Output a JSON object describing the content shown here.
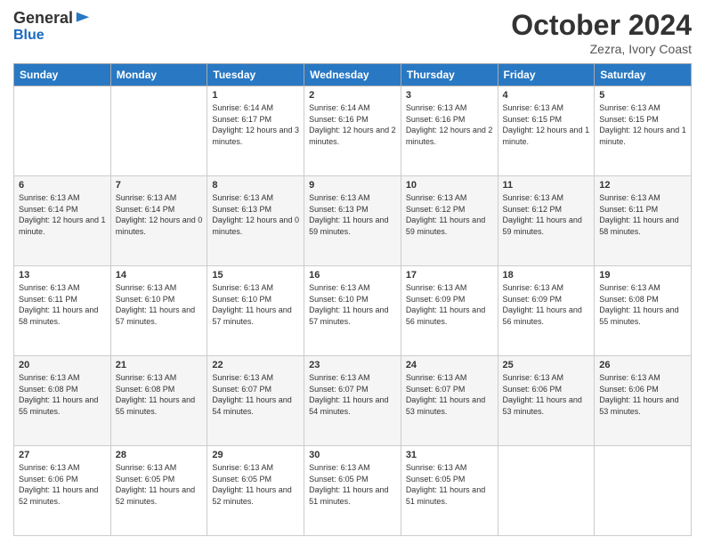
{
  "logo": {
    "general": "General",
    "blue": "Blue"
  },
  "header": {
    "month": "October 2024",
    "location": "Zezra, Ivory Coast"
  },
  "days_of_week": [
    "Sunday",
    "Monday",
    "Tuesday",
    "Wednesday",
    "Thursday",
    "Friday",
    "Saturday"
  ],
  "weeks": [
    [
      {
        "day": "",
        "info": ""
      },
      {
        "day": "",
        "info": ""
      },
      {
        "day": "1",
        "info": "Sunrise: 6:14 AM\nSunset: 6:17 PM\nDaylight: 12 hours and 3 minutes."
      },
      {
        "day": "2",
        "info": "Sunrise: 6:14 AM\nSunset: 6:16 PM\nDaylight: 12 hours and 2 minutes."
      },
      {
        "day": "3",
        "info": "Sunrise: 6:13 AM\nSunset: 6:16 PM\nDaylight: 12 hours and 2 minutes."
      },
      {
        "day": "4",
        "info": "Sunrise: 6:13 AM\nSunset: 6:15 PM\nDaylight: 12 hours and 1 minute."
      },
      {
        "day": "5",
        "info": "Sunrise: 6:13 AM\nSunset: 6:15 PM\nDaylight: 12 hours and 1 minute."
      }
    ],
    [
      {
        "day": "6",
        "info": "Sunrise: 6:13 AM\nSunset: 6:14 PM\nDaylight: 12 hours and 1 minute."
      },
      {
        "day": "7",
        "info": "Sunrise: 6:13 AM\nSunset: 6:14 PM\nDaylight: 12 hours and 0 minutes."
      },
      {
        "day": "8",
        "info": "Sunrise: 6:13 AM\nSunset: 6:13 PM\nDaylight: 12 hours and 0 minutes."
      },
      {
        "day": "9",
        "info": "Sunrise: 6:13 AM\nSunset: 6:13 PM\nDaylight: 11 hours and 59 minutes."
      },
      {
        "day": "10",
        "info": "Sunrise: 6:13 AM\nSunset: 6:12 PM\nDaylight: 11 hours and 59 minutes."
      },
      {
        "day": "11",
        "info": "Sunrise: 6:13 AM\nSunset: 6:12 PM\nDaylight: 11 hours and 59 minutes."
      },
      {
        "day": "12",
        "info": "Sunrise: 6:13 AM\nSunset: 6:11 PM\nDaylight: 11 hours and 58 minutes."
      }
    ],
    [
      {
        "day": "13",
        "info": "Sunrise: 6:13 AM\nSunset: 6:11 PM\nDaylight: 11 hours and 58 minutes."
      },
      {
        "day": "14",
        "info": "Sunrise: 6:13 AM\nSunset: 6:10 PM\nDaylight: 11 hours and 57 minutes."
      },
      {
        "day": "15",
        "info": "Sunrise: 6:13 AM\nSunset: 6:10 PM\nDaylight: 11 hours and 57 minutes."
      },
      {
        "day": "16",
        "info": "Sunrise: 6:13 AM\nSunset: 6:10 PM\nDaylight: 11 hours and 57 minutes."
      },
      {
        "day": "17",
        "info": "Sunrise: 6:13 AM\nSunset: 6:09 PM\nDaylight: 11 hours and 56 minutes."
      },
      {
        "day": "18",
        "info": "Sunrise: 6:13 AM\nSunset: 6:09 PM\nDaylight: 11 hours and 56 minutes."
      },
      {
        "day": "19",
        "info": "Sunrise: 6:13 AM\nSunset: 6:08 PM\nDaylight: 11 hours and 55 minutes."
      }
    ],
    [
      {
        "day": "20",
        "info": "Sunrise: 6:13 AM\nSunset: 6:08 PM\nDaylight: 11 hours and 55 minutes."
      },
      {
        "day": "21",
        "info": "Sunrise: 6:13 AM\nSunset: 6:08 PM\nDaylight: 11 hours and 55 minutes."
      },
      {
        "day": "22",
        "info": "Sunrise: 6:13 AM\nSunset: 6:07 PM\nDaylight: 11 hours and 54 minutes."
      },
      {
        "day": "23",
        "info": "Sunrise: 6:13 AM\nSunset: 6:07 PM\nDaylight: 11 hours and 54 minutes."
      },
      {
        "day": "24",
        "info": "Sunrise: 6:13 AM\nSunset: 6:07 PM\nDaylight: 11 hours and 53 minutes."
      },
      {
        "day": "25",
        "info": "Sunrise: 6:13 AM\nSunset: 6:06 PM\nDaylight: 11 hours and 53 minutes."
      },
      {
        "day": "26",
        "info": "Sunrise: 6:13 AM\nSunset: 6:06 PM\nDaylight: 11 hours and 53 minutes."
      }
    ],
    [
      {
        "day": "27",
        "info": "Sunrise: 6:13 AM\nSunset: 6:06 PM\nDaylight: 11 hours and 52 minutes."
      },
      {
        "day": "28",
        "info": "Sunrise: 6:13 AM\nSunset: 6:05 PM\nDaylight: 11 hours and 52 minutes."
      },
      {
        "day": "29",
        "info": "Sunrise: 6:13 AM\nSunset: 6:05 PM\nDaylight: 11 hours and 52 minutes."
      },
      {
        "day": "30",
        "info": "Sunrise: 6:13 AM\nSunset: 6:05 PM\nDaylight: 11 hours and 51 minutes."
      },
      {
        "day": "31",
        "info": "Sunrise: 6:13 AM\nSunset: 6:05 PM\nDaylight: 11 hours and 51 minutes."
      },
      {
        "day": "",
        "info": ""
      },
      {
        "day": "",
        "info": ""
      }
    ]
  ]
}
